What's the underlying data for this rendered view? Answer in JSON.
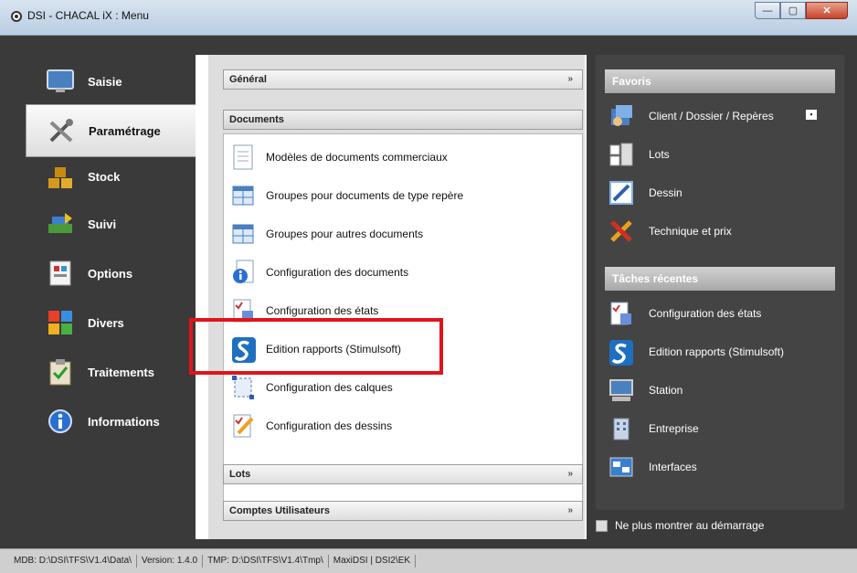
{
  "window": {
    "title": "DSI - CHACAL iX : Menu",
    "buttons": {
      "minimize": "—",
      "maximize": "▢",
      "close": "✕"
    }
  },
  "nav": [
    {
      "label": "Saisie",
      "icon": "monitor-icon",
      "active": false
    },
    {
      "label": "Paramétrage",
      "icon": "tools-icon",
      "active": true
    },
    {
      "label": "Stock",
      "icon": "boxes-icon",
      "active": false
    },
    {
      "label": "Suivi",
      "icon": "tracking-icon",
      "active": false
    },
    {
      "label": "Options",
      "icon": "options-icon",
      "active": false
    },
    {
      "label": "Divers",
      "icon": "colors-icon",
      "active": false
    },
    {
      "label": "Traitements",
      "icon": "clipboard-icon",
      "active": false
    },
    {
      "label": "Informations",
      "icon": "info-icon",
      "active": false
    }
  ],
  "middle": {
    "groups": {
      "general": "Général",
      "documents": "Documents",
      "lots": "Lots",
      "comptes": "Comptes Utilisateurs"
    },
    "items": [
      {
        "label": "Modèles de documents commerciaux",
        "icon": "document-icon"
      },
      {
        "label": "Groupes pour documents de type repère",
        "icon": "table-icon"
      },
      {
        "label": "Groupes pour autres documents",
        "icon": "table-icon"
      },
      {
        "label": "Configuration des documents",
        "icon": "info-document-icon"
      },
      {
        "label": "Configuration des états",
        "icon": "report-icon"
      },
      {
        "label": "Edition rapports (Stimulsoft)",
        "icon": "stimulsoft-icon"
      },
      {
        "label": "Configuration des calques",
        "icon": "layers-icon"
      },
      {
        "label": "Configuration des dessins",
        "icon": "drawing-icon"
      }
    ]
  },
  "right": {
    "favoris_title": "Favoris",
    "favoris": [
      {
        "label": "Client / Dossier / Repères",
        "icon": "client-icon"
      },
      {
        "label": "Lots",
        "icon": "lots-icon"
      },
      {
        "label": "Dessin",
        "icon": "pencil-icon"
      },
      {
        "label": "Technique et prix",
        "icon": "tools-icon"
      }
    ],
    "recent_title": "Tâches récentes",
    "recent": [
      {
        "label": "Configuration des états",
        "icon": "report-icon"
      },
      {
        "label": "Edition rapports (Stimulsoft)",
        "icon": "stimulsoft-icon"
      },
      {
        "label": "Station",
        "icon": "station-icon"
      },
      {
        "label": "Entreprise",
        "icon": "building-icon"
      },
      {
        "label": "Interfaces",
        "icon": "interfaces-icon"
      }
    ],
    "no_more": "Ne plus montrer au démarrage"
  },
  "status": [
    "MDB: D:\\DSI\\TFS\\V1.4\\Data\\",
    "Version: 1.4.0",
    "TMP: D:\\DSI\\TFS\\V1.4\\Tmp\\",
    "MaxiDSI | DSI2\\EK"
  ],
  "colors": {
    "highlight": "#e0141c",
    "background": "#3a3a3a"
  }
}
